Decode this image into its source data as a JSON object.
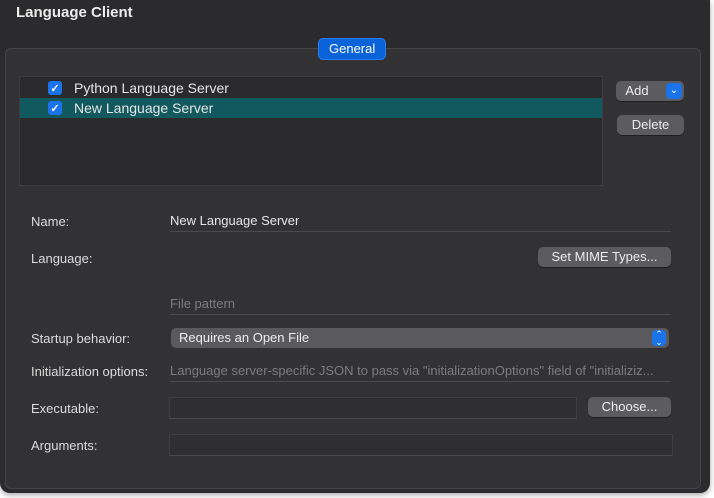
{
  "window": {
    "title": "Language Client"
  },
  "tabs": {
    "general": "General"
  },
  "servers": [
    {
      "name": "Python Language Server",
      "checked": true,
      "selected": false
    },
    {
      "name": "New Language Server",
      "checked": true,
      "selected": true
    }
  ],
  "buttons": {
    "add": "Add",
    "delete": "Delete",
    "set_mime": "Set MIME Types...",
    "choose": "Choose..."
  },
  "form": {
    "name_label": "Name:",
    "name_value": "New Language Server",
    "language_label": "Language:",
    "file_pattern_placeholder": "File pattern",
    "startup_label": "Startup behavior:",
    "startup_value": "Requires an Open File",
    "init_label": "Initialization options:",
    "init_placeholder": "Language server-specific JSON to pass via \"initializationOptions\" field of \"initializiz...",
    "executable_label": "Executable:",
    "arguments_label": "Arguments:"
  },
  "icons": {
    "checkbox": "checkmark-icon",
    "dropdown": "chevron-down-icon",
    "popup": "up-down-chevron-icon"
  },
  "colors": {
    "accent": "#1a73e8",
    "selection": "#11595f"
  }
}
